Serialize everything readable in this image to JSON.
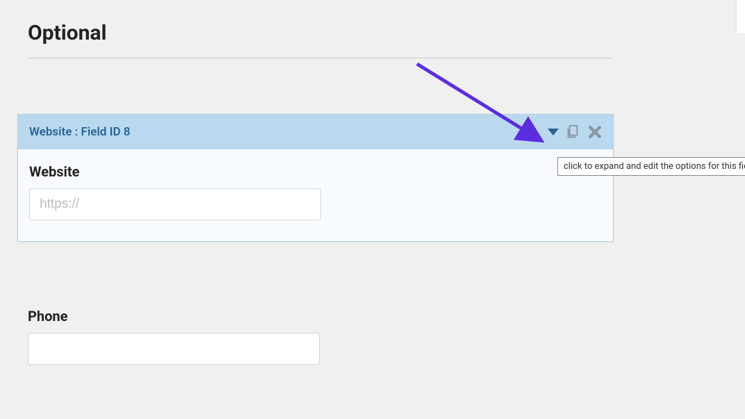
{
  "page": {
    "title": "Optional"
  },
  "field_card": {
    "header_label": "Website : Field ID 8",
    "label": "Website",
    "placeholder": "https://"
  },
  "phone_field": {
    "label": "Phone"
  },
  "tooltip": {
    "text": "click to expand and edit the options for this field"
  },
  "colors": {
    "arrow": "#5b2de0",
    "header_bg": "#bbd9ee",
    "header_text": "#2a6496",
    "icon_gray": "#8b98a6"
  }
}
